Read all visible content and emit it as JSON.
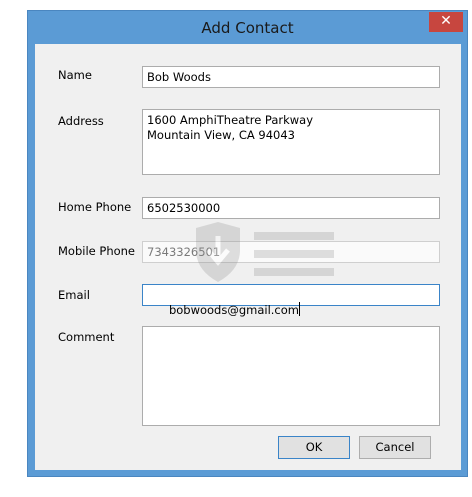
{
  "window": {
    "title": "Add Contact",
    "close_glyph": "✕",
    "accent_color": "#5b9bd5",
    "close_color": "#c7463f"
  },
  "form": {
    "name_label": "Name",
    "name_value": "Bob Woods",
    "address_label": "Address",
    "address_lines": [
      "1600 AmphiTheatre Parkway",
      "Mountain View, CA 94043"
    ],
    "home_phone_label": "Home Phone",
    "home_phone_value": "6502530000",
    "mobile_phone_label": "Mobile Phone",
    "mobile_phone_value": "7343326501",
    "email_label": "Email",
    "email_value": "bobwoods@gmail.com",
    "comment_label": "Comment",
    "comment_value": ""
  },
  "buttons": {
    "ok_label": "OK",
    "cancel_label": "Cancel"
  },
  "watermark": {
    "icon": "shield-download-icon"
  }
}
